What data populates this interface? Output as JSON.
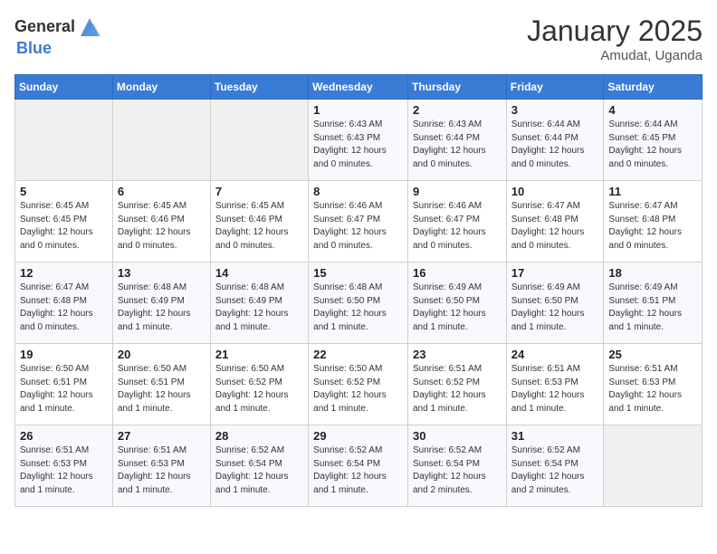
{
  "header": {
    "logo_general": "General",
    "logo_blue": "Blue",
    "month": "January 2025",
    "location": "Amudat, Uganda"
  },
  "days_of_week": [
    "Sunday",
    "Monday",
    "Tuesday",
    "Wednesday",
    "Thursday",
    "Friday",
    "Saturday"
  ],
  "weeks": [
    [
      {
        "day": "",
        "info": ""
      },
      {
        "day": "",
        "info": ""
      },
      {
        "day": "",
        "info": ""
      },
      {
        "day": "1",
        "info": "Sunrise: 6:43 AM\nSunset: 6:43 PM\nDaylight: 12 hours\nand 0 minutes."
      },
      {
        "day": "2",
        "info": "Sunrise: 6:43 AM\nSunset: 6:44 PM\nDaylight: 12 hours\nand 0 minutes."
      },
      {
        "day": "3",
        "info": "Sunrise: 6:44 AM\nSunset: 6:44 PM\nDaylight: 12 hours\nand 0 minutes."
      },
      {
        "day": "4",
        "info": "Sunrise: 6:44 AM\nSunset: 6:45 PM\nDaylight: 12 hours\nand 0 minutes."
      }
    ],
    [
      {
        "day": "5",
        "info": "Sunrise: 6:45 AM\nSunset: 6:45 PM\nDaylight: 12 hours\nand 0 minutes."
      },
      {
        "day": "6",
        "info": "Sunrise: 6:45 AM\nSunset: 6:46 PM\nDaylight: 12 hours\nand 0 minutes."
      },
      {
        "day": "7",
        "info": "Sunrise: 6:45 AM\nSunset: 6:46 PM\nDaylight: 12 hours\nand 0 minutes."
      },
      {
        "day": "8",
        "info": "Sunrise: 6:46 AM\nSunset: 6:47 PM\nDaylight: 12 hours\nand 0 minutes."
      },
      {
        "day": "9",
        "info": "Sunrise: 6:46 AM\nSunset: 6:47 PM\nDaylight: 12 hours\nand 0 minutes."
      },
      {
        "day": "10",
        "info": "Sunrise: 6:47 AM\nSunset: 6:48 PM\nDaylight: 12 hours\nand 0 minutes."
      },
      {
        "day": "11",
        "info": "Sunrise: 6:47 AM\nSunset: 6:48 PM\nDaylight: 12 hours\nand 0 minutes."
      }
    ],
    [
      {
        "day": "12",
        "info": "Sunrise: 6:47 AM\nSunset: 6:48 PM\nDaylight: 12 hours\nand 0 minutes."
      },
      {
        "day": "13",
        "info": "Sunrise: 6:48 AM\nSunset: 6:49 PM\nDaylight: 12 hours\nand 1 minute."
      },
      {
        "day": "14",
        "info": "Sunrise: 6:48 AM\nSunset: 6:49 PM\nDaylight: 12 hours\nand 1 minute."
      },
      {
        "day": "15",
        "info": "Sunrise: 6:48 AM\nSunset: 6:50 PM\nDaylight: 12 hours\nand 1 minute."
      },
      {
        "day": "16",
        "info": "Sunrise: 6:49 AM\nSunset: 6:50 PM\nDaylight: 12 hours\nand 1 minute."
      },
      {
        "day": "17",
        "info": "Sunrise: 6:49 AM\nSunset: 6:50 PM\nDaylight: 12 hours\nand 1 minute."
      },
      {
        "day": "18",
        "info": "Sunrise: 6:49 AM\nSunset: 6:51 PM\nDaylight: 12 hours\nand 1 minute."
      }
    ],
    [
      {
        "day": "19",
        "info": "Sunrise: 6:50 AM\nSunset: 6:51 PM\nDaylight: 12 hours\nand 1 minute."
      },
      {
        "day": "20",
        "info": "Sunrise: 6:50 AM\nSunset: 6:51 PM\nDaylight: 12 hours\nand 1 minute."
      },
      {
        "day": "21",
        "info": "Sunrise: 6:50 AM\nSunset: 6:52 PM\nDaylight: 12 hours\nand 1 minute."
      },
      {
        "day": "22",
        "info": "Sunrise: 6:50 AM\nSunset: 6:52 PM\nDaylight: 12 hours\nand 1 minute."
      },
      {
        "day": "23",
        "info": "Sunrise: 6:51 AM\nSunset: 6:52 PM\nDaylight: 12 hours\nand 1 minute."
      },
      {
        "day": "24",
        "info": "Sunrise: 6:51 AM\nSunset: 6:53 PM\nDaylight: 12 hours\nand 1 minute."
      },
      {
        "day": "25",
        "info": "Sunrise: 6:51 AM\nSunset: 6:53 PM\nDaylight: 12 hours\nand 1 minute."
      }
    ],
    [
      {
        "day": "26",
        "info": "Sunrise: 6:51 AM\nSunset: 6:53 PM\nDaylight: 12 hours\nand 1 minute."
      },
      {
        "day": "27",
        "info": "Sunrise: 6:51 AM\nSunset: 6:53 PM\nDaylight: 12 hours\nand 1 minute."
      },
      {
        "day": "28",
        "info": "Sunrise: 6:52 AM\nSunset: 6:54 PM\nDaylight: 12 hours\nand 1 minute."
      },
      {
        "day": "29",
        "info": "Sunrise: 6:52 AM\nSunset: 6:54 PM\nDaylight: 12 hours\nand 1 minute."
      },
      {
        "day": "30",
        "info": "Sunrise: 6:52 AM\nSunset: 6:54 PM\nDaylight: 12 hours\nand 2 minutes."
      },
      {
        "day": "31",
        "info": "Sunrise: 6:52 AM\nSunset: 6:54 PM\nDaylight: 12 hours\nand 2 minutes."
      },
      {
        "day": "",
        "info": ""
      }
    ]
  ]
}
